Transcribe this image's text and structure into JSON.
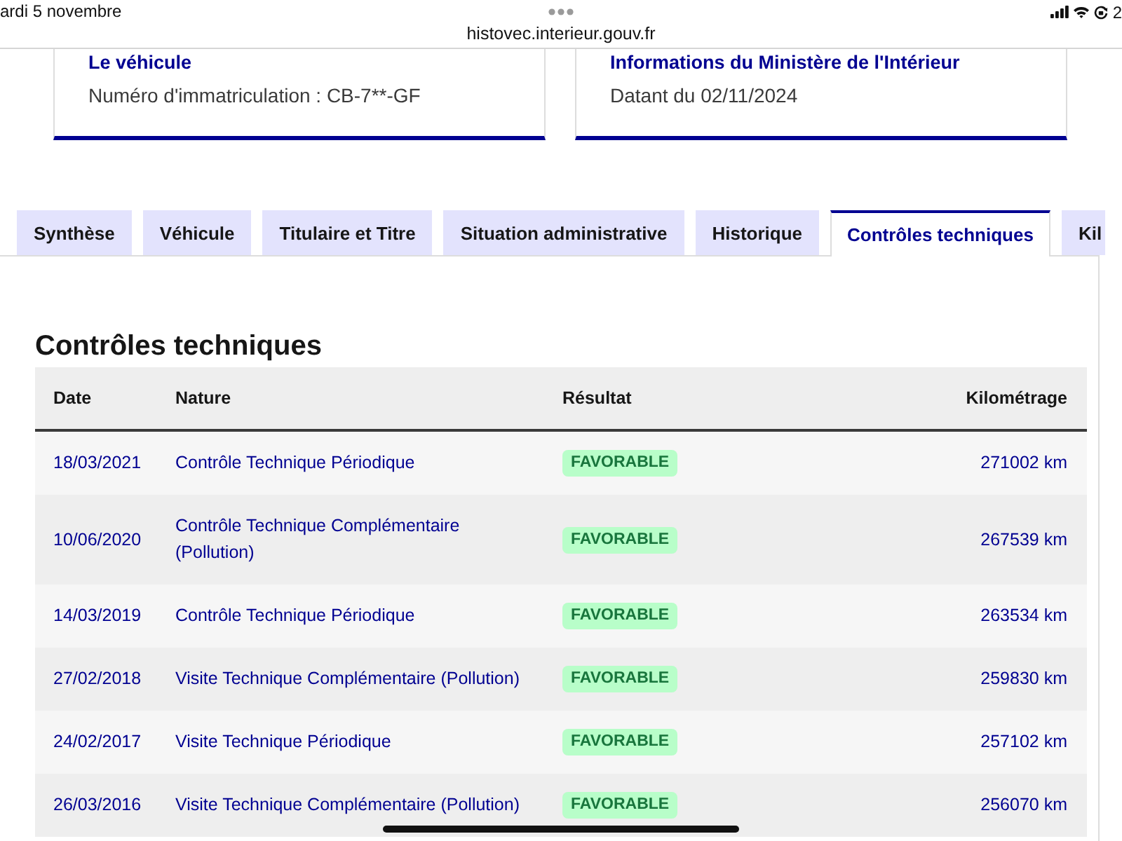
{
  "status_bar": {
    "date": "ardi 5 novembre",
    "trailing_text": "2"
  },
  "address_bar": {
    "url": "histovec.interieur.gouv.fr"
  },
  "cards": [
    {
      "title": "Le véhicule",
      "text": "Numéro d'immatriculation : CB-7**-GF"
    },
    {
      "title": "Informations du Ministère de l'Intérieur",
      "text": "Datant du 02/11/2024"
    }
  ],
  "tabs": [
    {
      "label": "Synthèse",
      "selected": false
    },
    {
      "label": "Véhicule",
      "selected": false
    },
    {
      "label": "Titulaire et Titre",
      "selected": false
    },
    {
      "label": "Situation administrative",
      "selected": false
    },
    {
      "label": "Historique",
      "selected": false
    },
    {
      "label": "Contrôles techniques",
      "selected": true
    },
    {
      "label": "Kil",
      "selected": false
    }
  ],
  "section": {
    "title": "Contrôles techniques"
  },
  "table": {
    "columns": [
      "Date",
      "Nature",
      "Résultat",
      "Kilométrage"
    ],
    "rows": [
      {
        "date": "18/03/2021",
        "nature": "Contrôle Technique Périodique",
        "result": "FAVORABLE",
        "mileage": "271002 km"
      },
      {
        "date": "10/06/2020",
        "nature": "Contrôle Technique Complémentaire (Pollution)",
        "result": "FAVORABLE",
        "mileage": "267539 km"
      },
      {
        "date": "14/03/2019",
        "nature": "Contrôle Technique Périodique",
        "result": "FAVORABLE",
        "mileage": "263534 km"
      },
      {
        "date": "27/02/2018",
        "nature": "Visite Technique Complémentaire (Pollution)",
        "result": "FAVORABLE",
        "mileage": "259830 km"
      },
      {
        "date": "24/02/2017",
        "nature": "Visite Technique Périodique",
        "result": "FAVORABLE",
        "mileage": "257102 km"
      },
      {
        "date": "26/03/2016",
        "nature": "Visite Technique Complémentaire (Pollution)",
        "result": "FAVORABLE",
        "mileage": "256070 km"
      }
    ]
  }
}
